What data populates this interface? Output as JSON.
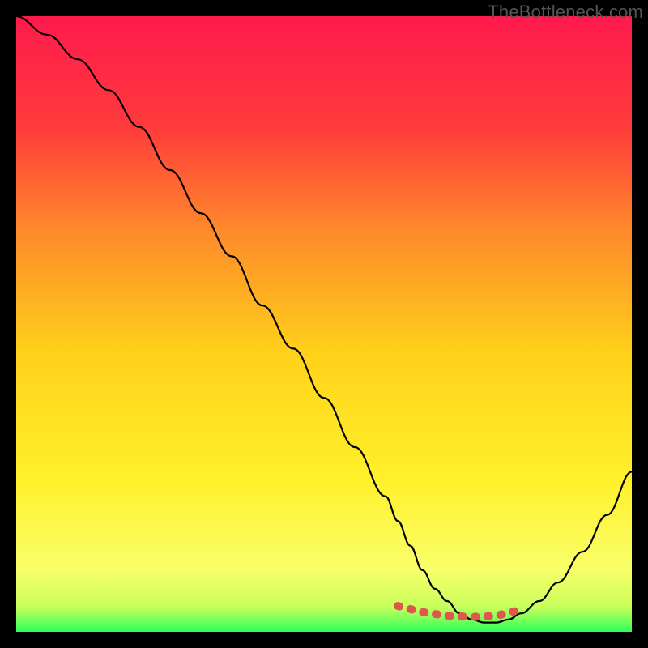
{
  "watermark": "TheBottleneck.com",
  "chart_data": {
    "type": "line",
    "title": "",
    "xlabel": "",
    "ylabel": "",
    "xlim": [
      0,
      100
    ],
    "ylim": [
      0,
      100
    ],
    "grid": false,
    "legend": false,
    "series": [
      {
        "name": "bottleneck-curve",
        "x": [
          0,
          5,
          10,
          15,
          20,
          25,
          30,
          35,
          40,
          45,
          50,
          55,
          60,
          62,
          64,
          66,
          68,
          70,
          72,
          74,
          76,
          78,
          80,
          82,
          85,
          88,
          92,
          96,
          100
        ],
        "y": [
          100,
          97,
          93,
          88,
          82,
          75,
          68,
          61,
          53,
          46,
          38,
          30,
          22,
          18,
          14,
          10,
          7,
          5,
          3,
          2,
          1.5,
          1.5,
          2,
          3,
          5,
          8,
          13,
          19,
          26
        ]
      }
    ],
    "highlight_segment": {
      "name": "optimal-range",
      "x": [
        62,
        66,
        70,
        74,
        78,
        82
      ],
      "y": [
        4.2,
        3.2,
        2.6,
        2.4,
        2.6,
        3.6
      ]
    },
    "gradient_stops": [
      {
        "offset": 0,
        "color": "#ff1a4d"
      },
      {
        "offset": 18,
        "color": "#ff3b3b"
      },
      {
        "offset": 35,
        "color": "#ff8a2a"
      },
      {
        "offset": 55,
        "color": "#ffd21a"
      },
      {
        "offset": 75,
        "color": "#fff02a"
      },
      {
        "offset": 90,
        "color": "#f9ff6a"
      },
      {
        "offset": 96,
        "color": "#c8ff5a"
      },
      {
        "offset": 100,
        "color": "#2dff5a"
      }
    ]
  }
}
